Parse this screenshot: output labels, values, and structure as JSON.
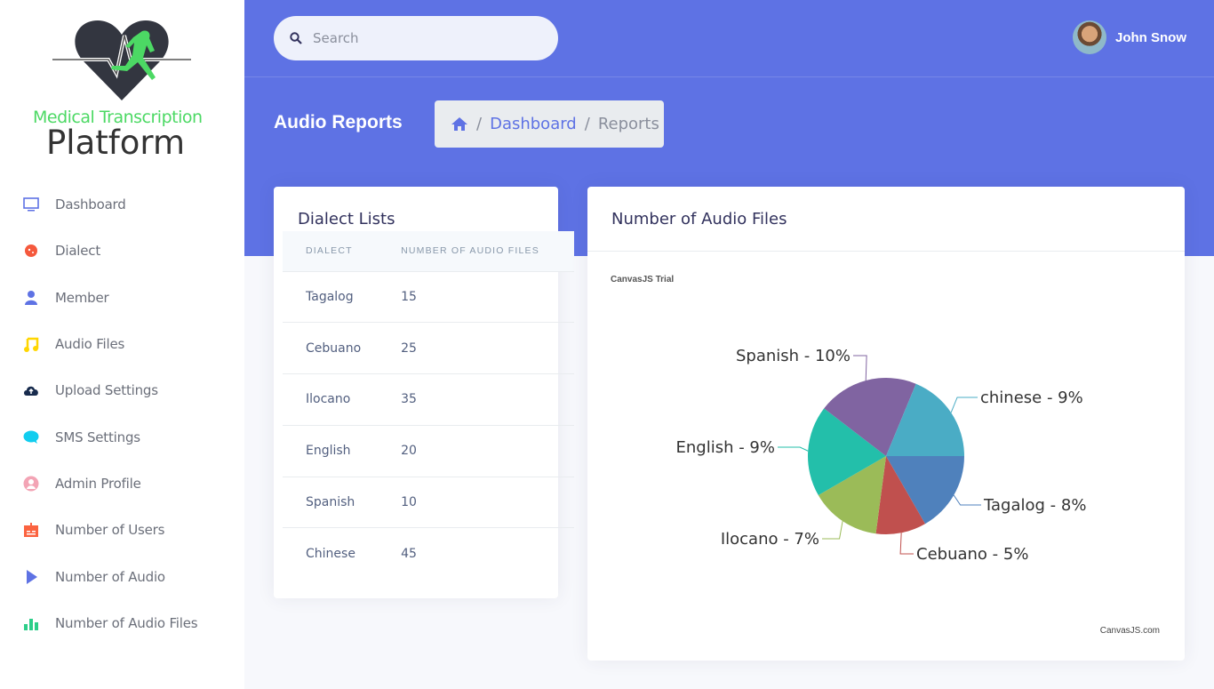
{
  "logo": {
    "line1": "Medical Transcription",
    "line2": "Platform"
  },
  "sidebar": {
    "items": [
      {
        "label": "Dashboard",
        "icon": "monitor-icon",
        "color": "#5e72e4"
      },
      {
        "label": "Dialect",
        "icon": "planet-icon",
        "color": "#f5593d"
      },
      {
        "label": "Member",
        "icon": "user-icon",
        "color": "#5e72e4"
      },
      {
        "label": "Audio Files",
        "icon": "music-note-icon",
        "color": "#ffd600"
      },
      {
        "label": "Upload Settings",
        "icon": "cloud-upload-icon",
        "color": "#172b4d"
      },
      {
        "label": "SMS Settings",
        "icon": "chat-bubble-icon",
        "color": "#11cdef"
      },
      {
        "label": "Admin Profile",
        "icon": "user-circle-icon",
        "color": "#f3a4b5"
      },
      {
        "label": "Number of Users",
        "icon": "id-badge-icon",
        "color": "#fb6340"
      },
      {
        "label": "Number of Audio",
        "icon": "play-icon",
        "color": "#5e72e4"
      },
      {
        "label": "Number of Audio Files",
        "icon": "bar-chart-icon",
        "color": "#2dce89"
      }
    ]
  },
  "header": {
    "search_placeholder": "Search",
    "user_name": "John Snow"
  },
  "page": {
    "title": "Audio Reports",
    "breadcrumb": [
      "Dashboard",
      "Reports"
    ]
  },
  "dialects": {
    "title": "Dialect Lists",
    "columns": [
      "DIALECT",
      "NUMBER OF AUDIO FILES"
    ],
    "rows": [
      [
        "Tagalog",
        "15"
      ],
      [
        "Cebuano",
        "25"
      ],
      [
        "Ilocano",
        "35"
      ],
      [
        "English",
        "20"
      ],
      [
        "Spanish",
        "10"
      ],
      [
        "Chinese",
        "45"
      ]
    ]
  },
  "audio_chart": {
    "title": "Number of Audio Files",
    "trial": "CanvasJS Trial",
    "credit": "CanvasJS.com"
  },
  "chart_data": {
    "type": "pie",
    "title": "",
    "categories": [
      "Tagalog",
      "Cebuano",
      "Ilocano",
      "English",
      "Spanish",
      "chinese"
    ],
    "values": [
      8,
      5,
      7,
      9,
      10,
      9
    ],
    "labels": [
      "Tagalog - 8%",
      "Cebuano - 5%",
      "Ilocano - 7%",
      "English - 9%",
      "Spanish - 10%",
      "chinese - 9%"
    ],
    "colors": [
      "#4F81BC",
      "#C0504E",
      "#9BBB58",
      "#23BFAA",
      "#8064A1",
      "#4AACC5"
    ]
  }
}
